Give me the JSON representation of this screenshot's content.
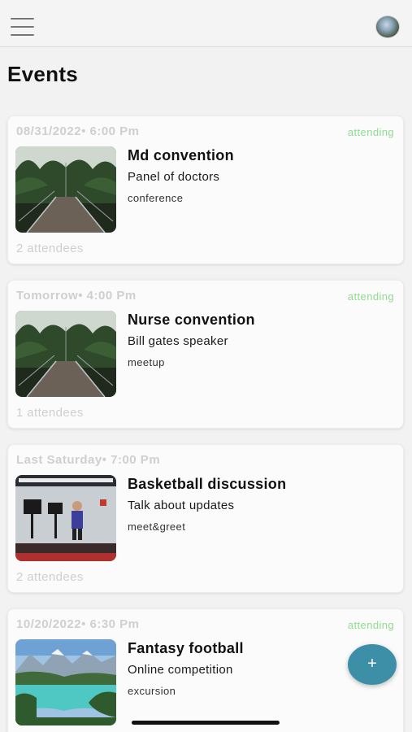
{
  "header": {
    "menu_icon": "hamburger-menu-icon",
    "avatar_icon": "user-avatar"
  },
  "page": {
    "title": "Events"
  },
  "events": [
    {
      "when": "08/31/2022• 6:00 Pm",
      "status": "attending",
      "title": "Md convention",
      "description": "Panel of doctors",
      "tag": "conference",
      "attendees": "2 attendees",
      "image": "bridge-forest-image"
    },
    {
      "when": "Tomorrow• 4:00 Pm",
      "status": "attending",
      "title": "Nurse convention",
      "description": "Bill gates speaker",
      "tag": "meetup",
      "attendees": "1 attendees",
      "image": "bridge-forest-image"
    },
    {
      "when": "Last Saturday• 7:00 Pm",
      "status": "",
      "title": "Basketball discussion",
      "description": "Talk about updates",
      "tag": "meet&greet",
      "attendees": "2 attendees",
      "image": "studio-presenter-image"
    },
    {
      "when": "10/20/2022• 6:30 Pm",
      "status": "attending",
      "title": "Fantasy football",
      "description": "Online competition",
      "tag": "excursion",
      "attendees": "",
      "image": "mountain-lake-image"
    }
  ],
  "fab": {
    "label": "+",
    "icon": "plus-icon"
  },
  "colors": {
    "attending": "#8fdc8f",
    "fab": "#3d8fa8",
    "muted_text": "#cfcfcf"
  }
}
